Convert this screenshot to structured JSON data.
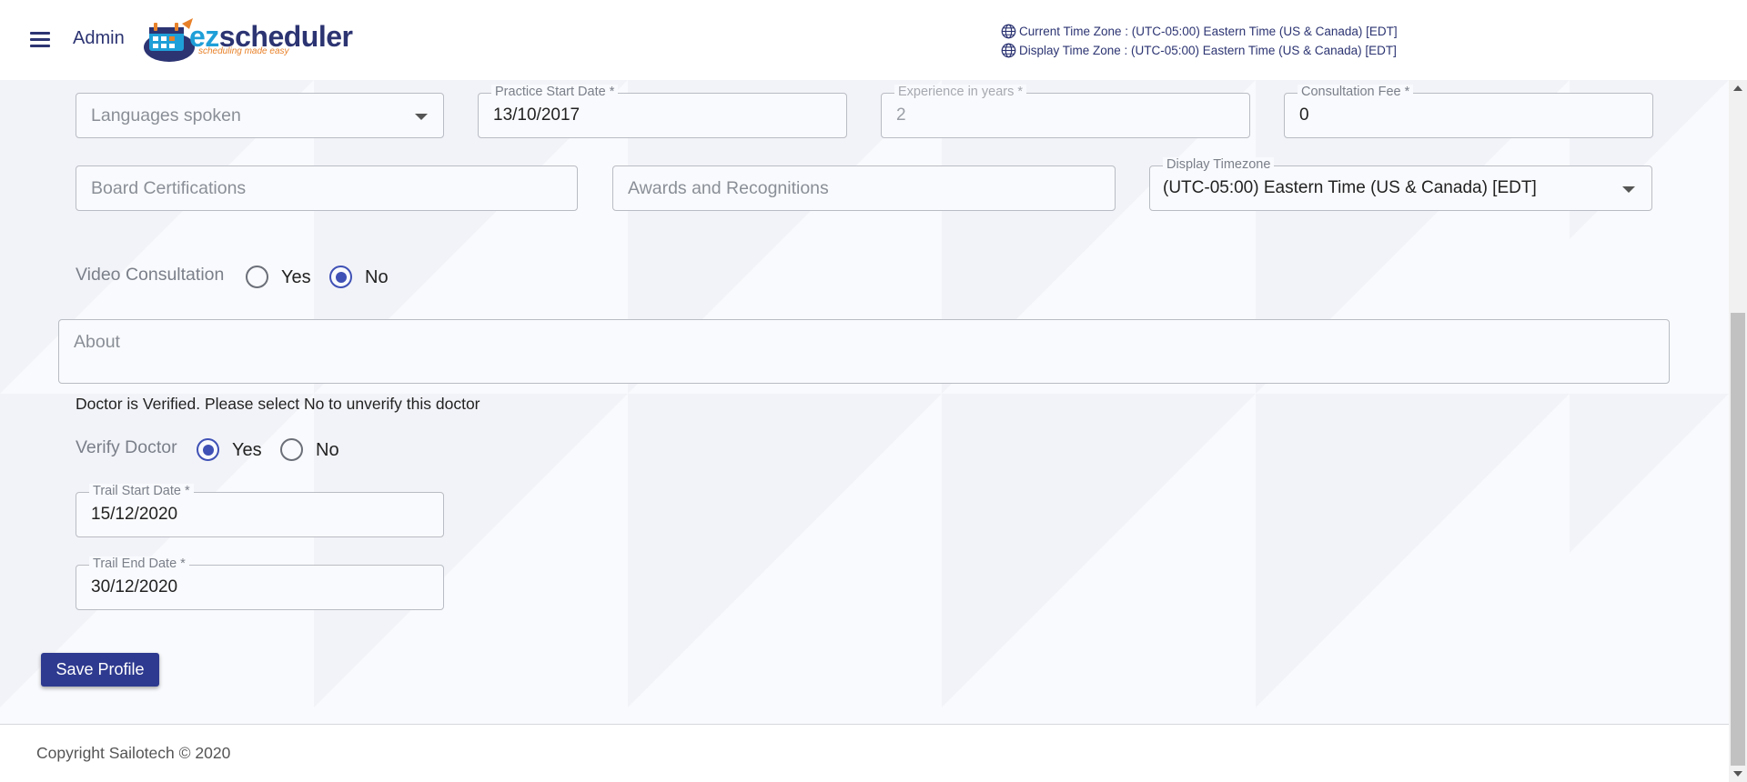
{
  "header": {
    "menu_icon": "hamburger-menu-icon",
    "role_label": "Admin",
    "logo": {
      "brand_prefix": "ez",
      "brand_rest": "scheduler",
      "tagline": "scheduling made easy"
    },
    "current_timezone": "Current Time Zone : (UTC-05:00) Eastern Time (US & Canada) [EDT]",
    "display_timezone": "Display Time Zone : (UTC-05:00) Eastern Time (US & Canada) [EDT]",
    "globe_icon": "globe-icon"
  },
  "form": {
    "languages_spoken": {
      "placeholder": "Languages spoken"
    },
    "practice_start_date": {
      "label": "Practice Start Date *",
      "value": "13/10/2017"
    },
    "experience_years": {
      "label": "Experience in years *",
      "value": "2"
    },
    "consultation_fee": {
      "label": "Consultation Fee  *",
      "value": "0"
    },
    "board_certifications": {
      "placeholder": "Board Certifications"
    },
    "awards": {
      "placeholder": "Awards and Recognitions"
    },
    "display_timezone": {
      "label": "Display Timezone",
      "value": "(UTC-05:00) Eastern Time (US & Canada) [EDT]"
    },
    "video_consultation": {
      "label": "Video Consultation",
      "yes": "Yes",
      "no": "No",
      "selected": "No"
    },
    "about": {
      "placeholder": "About"
    },
    "verified_note": "Doctor is Verified. Please select No to unverify this doctor",
    "verify_doctor": {
      "label": "Verify Doctor",
      "yes": "Yes",
      "no": "No",
      "selected": "Yes"
    },
    "trail_start_date": {
      "label": "Trail Start Date *",
      "value": "15/12/2020"
    },
    "trail_end_date": {
      "label": "Trail End Date *",
      "value": "30/12/2020"
    },
    "save_button": "Save Profile"
  },
  "footer": {
    "copyright": "Copyright Sailotech © 2020"
  },
  "colors": {
    "primary": "#2e3a8f",
    "radio_accent": "#3f51b5",
    "brand_blue": "#1f9fd8",
    "brand_orange": "#e8822a"
  }
}
